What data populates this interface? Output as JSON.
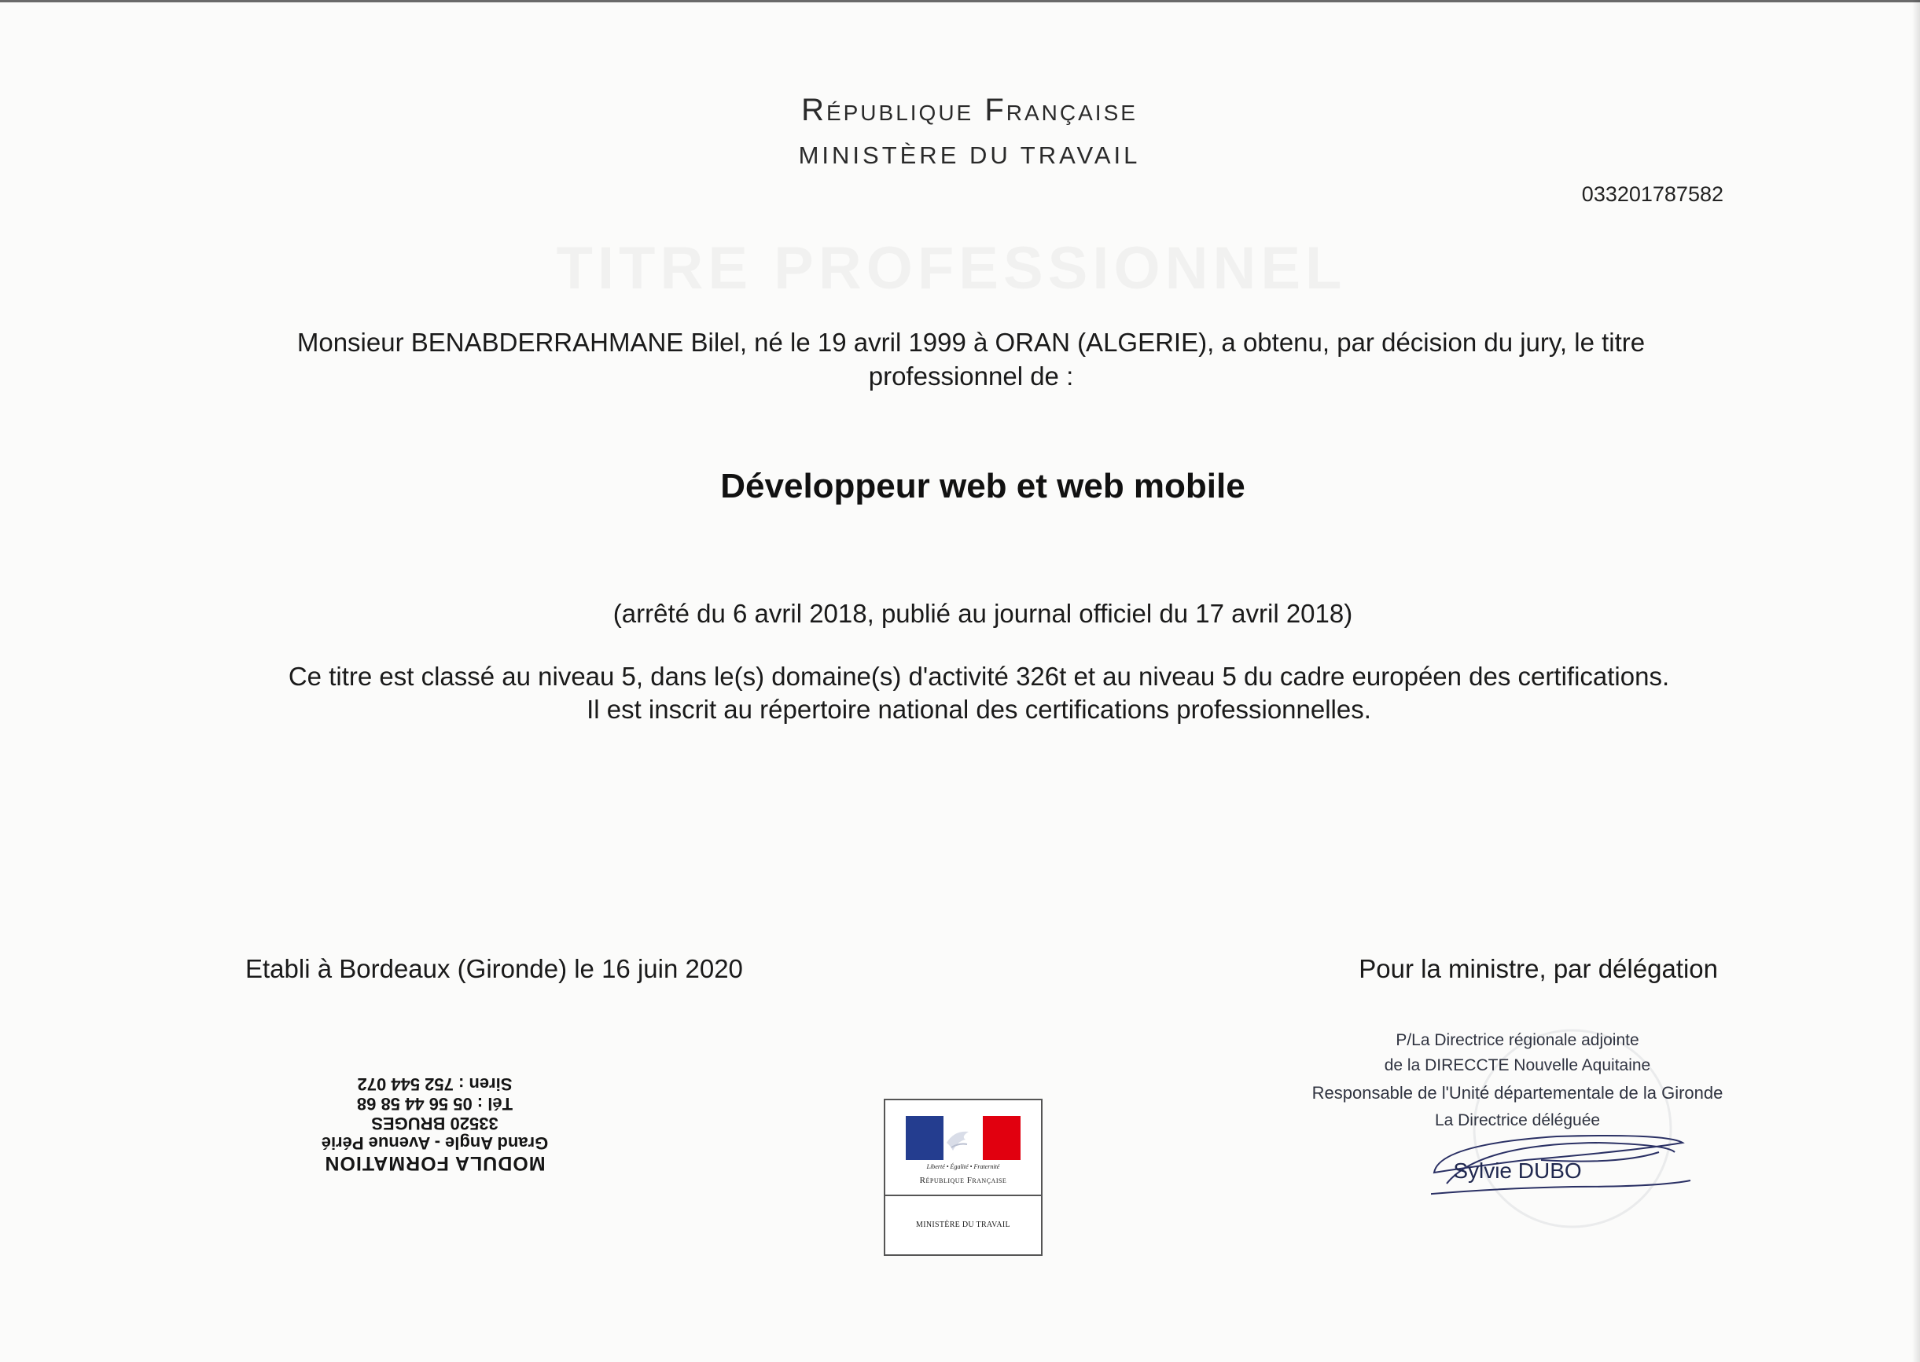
{
  "header": {
    "republic": "République Française",
    "ministry": "MINISTÈRE DU TRAVAIL",
    "certificate_number": "033201787582"
  },
  "certificate": {
    "holder_text": "Monsieur BENABDERRAHMANE Bilel, né le 19 avril 1999 à ORAN (ALGERIE), a obtenu, par décision du jury, le titre professionnel de :",
    "title": "Développeur web et web mobile",
    "decree": "(arrêté du 6 avril 2018, publié au journal officiel du 17 avril 2018)",
    "classification_line1": "Ce titre est classé au niveau 5, dans le(s) domaine(s) d'activité 326t et au niveau 5 du cadre européen des certifications.",
    "classification_line2": "Il est inscrit au répertoire national des certifications professionnelles."
  },
  "footer": {
    "issued": "Etabli à Bordeaux (Gironde) le 16 juin 2020",
    "delegation": "Pour la ministre, par délégation"
  },
  "org_stamp": {
    "name": "MODULA FORMATION",
    "address": "Grand Angle - Avenue Périé",
    "city": "33520 BRUGES",
    "phone": "Tél : 05 56 44 58 68",
    "siren": "Siren : 752 544 072"
  },
  "logo": {
    "motto": "Liberté • Égalité • Fraternité",
    "republic": "République Française",
    "ministry": "MINISTÈRE DU TRAVAIL",
    "colors": {
      "blue": "#243d8f",
      "white": "#ffffff",
      "red": "#e1000f"
    }
  },
  "signature_block": {
    "line1": "P/La Directrice régionale adjointe",
    "line2": "de la DIRECCTE Nouvelle Aquitaine",
    "line3": "Responsable de l'Unité départementale de la Gironde",
    "line4": "La Directrice déléguée",
    "signer": "Sylvie DUBO"
  }
}
